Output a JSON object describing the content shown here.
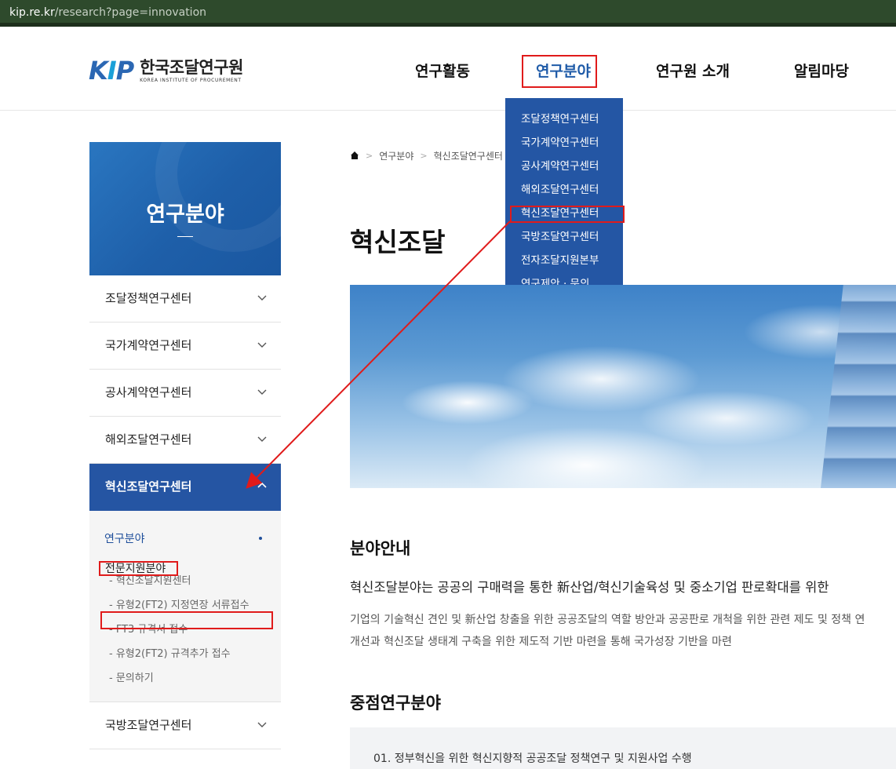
{
  "browser": {
    "url_host": "kip.re.kr",
    "url_path": "/research?page=innovation"
  },
  "logo": {
    "mark_k": "K",
    "mark_i": "I",
    "mark_p": "P",
    "name_ko": "한국조달연구원",
    "name_en": "KOREA INSTITUTE OF PROCUREMENT"
  },
  "gnb": {
    "items": [
      {
        "label": "연구활동"
      },
      {
        "label": "연구분야"
      },
      {
        "label": "연구원 소개"
      },
      {
        "label": "알림마당"
      }
    ]
  },
  "dropdown": {
    "items": [
      "조달정책연구센터",
      "국가계약연구센터",
      "공사계약연구센터",
      "해외조달연구센터",
      "혁신조달연구센터",
      "국방조달연구센터",
      "전자조달지원본부",
      "연구제안 · 문의"
    ]
  },
  "sidebar": {
    "title": "연구분야",
    "items": [
      "조달정책연구센터",
      "국가계약연구센터",
      "공사계약연구센터",
      "해외조달연구센터",
      "혁신조달연구센터",
      "국방조달연구센터"
    ],
    "submenu": {
      "header": "연구분야",
      "group": "전문지원분야",
      "links": [
        "- 혁신조달지원센터",
        "- 유형2(FT2) 지정연장 서류접수",
        "- FT3 규격서 접수",
        "- 유형2(FT2) 규격추가 접수",
        "- 문의하기"
      ]
    }
  },
  "breadcrumb": {
    "items": [
      "연구분야",
      "혁신조달연구센터"
    ]
  },
  "main": {
    "title": "혁신조달",
    "section1_title": "분야안내",
    "lead": "혁신조달분야는 공공의 구매력을 통한 新산업/혁신기술육성 및 중소기업 판로확대를 위한",
    "desc_line1": "기업의 기술혁신 견인 및 新산업 창출을 위한 공공조달의 역할 방안과 공공판로 개척을 위한 관련 제도 및 정책 연",
    "desc_line2": "개선과 혁신조달 생태계 구축을 위한 제도적 기반 마련을 통해 국가성장 기반을 마련",
    "section2_title": "중점연구분야",
    "focus_items": [
      "01. 정부혁신을 위한 혁신지향적 공공조달 정책연구 및 지원사업 수행"
    ]
  },
  "colors": {
    "brand_blue": "#2456a4",
    "highlight_red": "#e01b1b",
    "url_bar": "#2e4a2c"
  },
  "icons": {
    "home": "home-icon",
    "chevron_down": "chevron-down-icon",
    "chevron_up": "chevron-up-icon"
  }
}
